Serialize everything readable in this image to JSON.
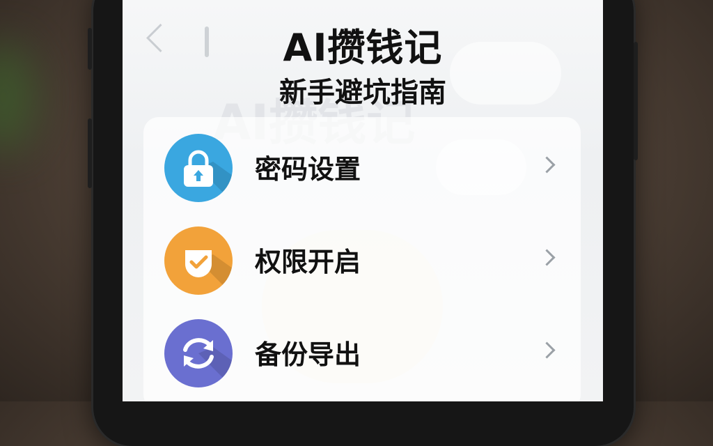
{
  "header": {
    "title": "AI攒钱记",
    "subtitle": "新手避坑指南",
    "watermark": "AI攒钱记"
  },
  "menu": {
    "items": [
      {
        "label": "密码设置",
        "icon": "lock-icon",
        "color": "#3aa7e0"
      },
      {
        "label": "权限开启",
        "icon": "check-shield-icon",
        "color": "#f2a23a"
      },
      {
        "label": "备份导出",
        "icon": "sync-icon",
        "color": "#6a6fd0"
      }
    ]
  }
}
